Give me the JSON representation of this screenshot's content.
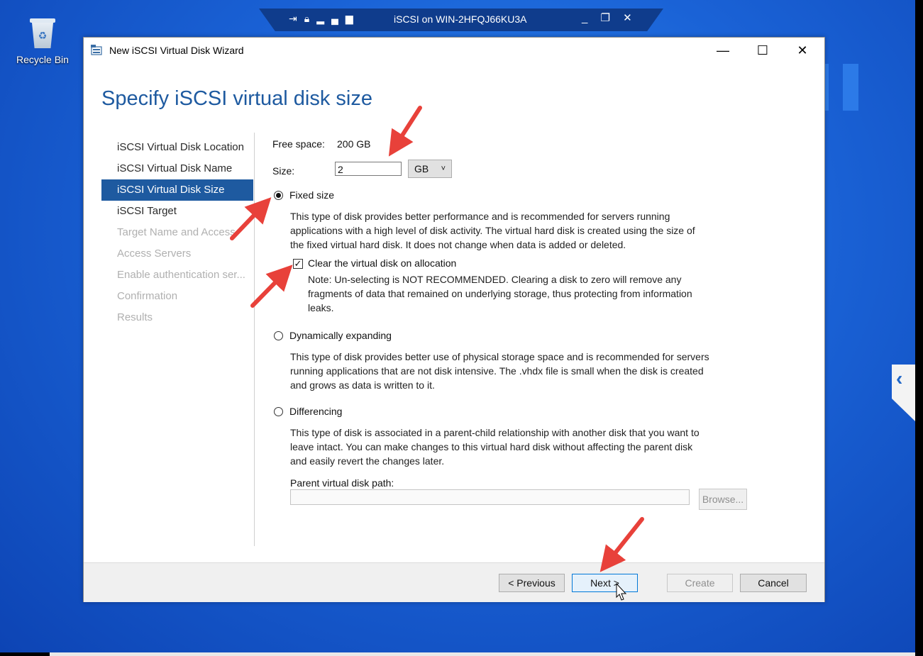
{
  "desktop": {
    "recycle_bin_label": "Recycle Bin"
  },
  "rdp_bar": {
    "title": "iSCSI on WIN-2HFQJ66KU3A",
    "left_icons": [
      "pin-icon",
      "lock-icon",
      "signal-icon"
    ],
    "right_icons": [
      "minimize-icon",
      "restore-icon",
      "close-icon"
    ]
  },
  "window": {
    "title": "New iSCSI Virtual Disk Wizard",
    "heading": "Specify iSCSI virtual disk size"
  },
  "nav": {
    "items": [
      {
        "label": "iSCSI Virtual Disk Location",
        "state": "normal"
      },
      {
        "label": "iSCSI Virtual Disk Name",
        "state": "normal"
      },
      {
        "label": "iSCSI Virtual Disk Size",
        "state": "active"
      },
      {
        "label": "iSCSI Target",
        "state": "normal"
      },
      {
        "label": "Target Name and Access",
        "state": "disabled"
      },
      {
        "label": "Access Servers",
        "state": "disabled"
      },
      {
        "label": "Enable authentication ser...",
        "state": "disabled"
      },
      {
        "label": "Confirmation",
        "state": "disabled"
      },
      {
        "label": "Results",
        "state": "disabled"
      }
    ]
  },
  "form": {
    "free_space_label": "Free space:",
    "free_space_value": "200 GB",
    "size_label": "Size:",
    "size_value": "2",
    "unit_value": "GB",
    "fixed": {
      "label": "Fixed size",
      "selected": true,
      "desc_lines": [
        "This type of disk provides better performance and is recommended for servers running",
        "applications with a high level of disk activity. The virtual hard disk is created using the size of",
        "the fixed virtual hard disk. It does not change when data is added or deleted."
      ],
      "clear_label": "Clear the virtual disk on allocation",
      "clear_checked": true,
      "note_lines": [
        "Note: Un-selecting is NOT RECOMMENDED. Clearing a disk to zero will remove any",
        "fragments of data that remained on underlying storage, thus protecting from information",
        "leaks."
      ]
    },
    "dynamic": {
      "label": "Dynamically expanding",
      "selected": false,
      "desc_lines": [
        "This type of disk provides better use of physical storage space and is recommended for servers",
        "running applications that are not disk intensive. The .vhdx file is small when the disk is created",
        "and grows as data is written to it."
      ]
    },
    "differencing": {
      "label": "Differencing",
      "selected": false,
      "desc_lines": [
        "This type of disk is associated in a parent-child relationship with another disk that you want to",
        "leave intact. You can make changes to this virtual hard disk without affecting the parent disk",
        "and easily revert the changes later."
      ],
      "parent_path_label": "Parent virtual disk path:",
      "parent_path_value": "",
      "browse_label": "Browse..."
    }
  },
  "footer": {
    "previous_label": "< Previous",
    "next_label": "Next >",
    "create_label": "Create",
    "cancel_label": "Cancel"
  },
  "colors": {
    "accent": "#1e5aa0",
    "annotation": "#e8413a"
  }
}
